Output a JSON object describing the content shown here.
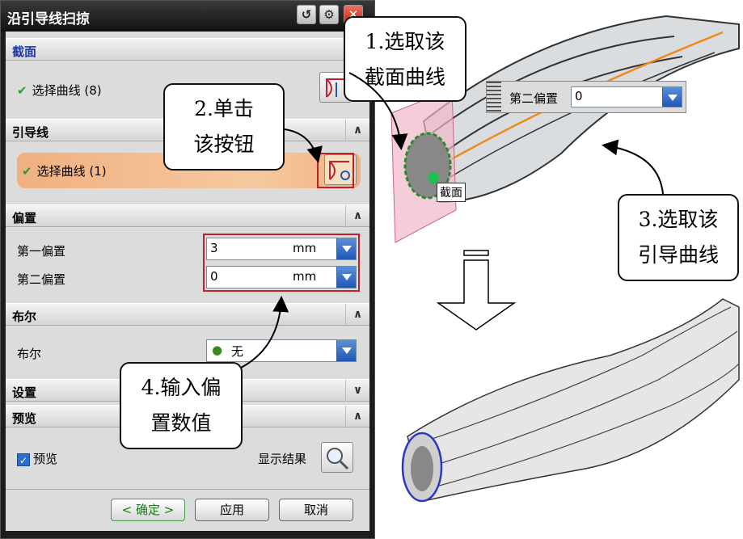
{
  "dialog": {
    "title": "沿引导线扫掠",
    "section_label": "截面",
    "section_select": "选择曲线 (8)",
    "guide_label": "引导线",
    "guide_select": "选择曲线 (1)",
    "offset_label": "偏置",
    "first_offset_label": "第一偏置",
    "first_offset_value": "3",
    "first_offset_unit": "mm",
    "second_offset_label": "第二偏置",
    "second_offset_value": "0",
    "second_offset_unit": "mm",
    "boolean_section_label": "布尔",
    "boolean_label": "布尔",
    "boolean_value": "无",
    "settings_label": "设置",
    "preview_section_label": "预览",
    "preview_checkbox_label": "预览",
    "show_result_label": "显示结果",
    "ok_label": "< 确定 >",
    "apply_label": "应用",
    "cancel_label": "取消"
  },
  "callouts": {
    "c1_line1": "1.选取该",
    "c1_line2": "截面曲线",
    "c2_line1": "2.单击",
    "c2_line2": "该按钮",
    "c3_line1": "3.选取该",
    "c3_line2": "引导曲线",
    "c4_line1": "4.输入偏",
    "c4_line2": "置数值"
  },
  "viewport": {
    "second_offset_label": "第二偏置",
    "second_offset_value": "0",
    "section_tag": "截面"
  },
  "colors": {
    "accent_red": "#c0202a",
    "select_highlight": "#f0b080",
    "dropdown_blue": "#1f57b5",
    "guide_curve": "#f08a1c"
  }
}
